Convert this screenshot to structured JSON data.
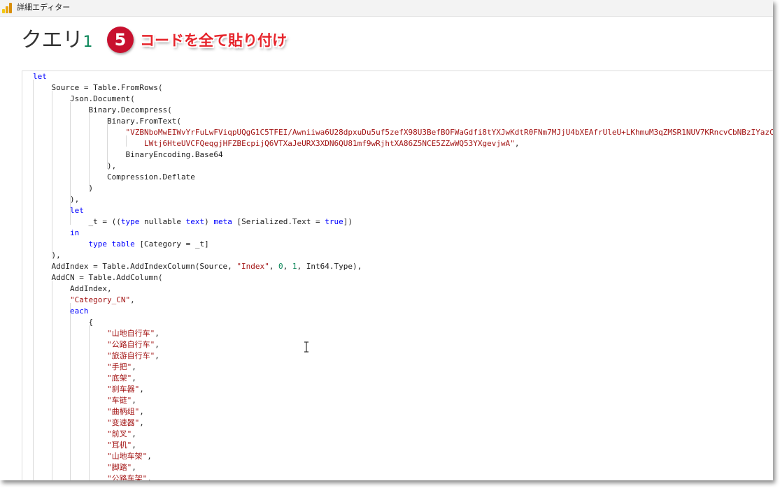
{
  "window": {
    "title": "詳細エディター"
  },
  "header": {
    "query_name": "クエリ",
    "query_number": "1",
    "step_number": "5",
    "step_caption": "コードを全て貼り付け"
  },
  "colors": {
    "keyword": "#0000ff",
    "string": "#a31515",
    "number": "#098658",
    "badge": "#c8102e",
    "caption": "#e6242b"
  },
  "editor": {
    "lines": [
      {
        "indent": 0,
        "tokens": [
          {
            "t": "let",
            "c": "kw"
          }
        ]
      },
      {
        "indent": 1,
        "tokens": [
          {
            "t": "Source = Table.FromRows(",
            "c": ""
          }
        ]
      },
      {
        "indent": 2,
        "tokens": [
          {
            "t": "Json.Document(",
            "c": ""
          }
        ]
      },
      {
        "indent": 3,
        "tokens": [
          {
            "t": "Binary.Decompress(",
            "c": ""
          }
        ]
      },
      {
        "indent": 4,
        "tokens": [
          {
            "t": "Binary.FromText(",
            "c": ""
          }
        ]
      },
      {
        "indent": 5,
        "tokens": [
          {
            "t": "\"VZBNboMwEIWvYrFuLwFViqpUQgG1C5TFEI/Awniiwa6U28dpxuDu5uf5zefX98U3BefBOFWaGdfi8tYXJwKdtR0FNm7MJjU4bXEAfrUleU+LKhmuM3qZMSR1NUV7KRncvCbNBzIYazC",
            "c": "str"
          }
        ]
      },
      {
        "indent": 6,
        "tokens": [
          {
            "t": "LWtj6HteUVCFQeqgjHFZBEcpijQ6VTXaJeURX3XDN6QU81mf9wRjhtXA86Z5NCE5ZZwWQ53YXgevjwA\"",
            "c": "str"
          },
          {
            "t": ",",
            "c": ""
          }
        ]
      },
      {
        "indent": 5,
        "tokens": [
          {
            "t": "BinaryEncoding.Base64",
            "c": ""
          }
        ]
      },
      {
        "indent": 4,
        "tokens": [
          {
            "t": "),",
            "c": ""
          }
        ]
      },
      {
        "indent": 4,
        "tokens": [
          {
            "t": "Compression.Deflate",
            "c": ""
          }
        ]
      },
      {
        "indent": 3,
        "tokens": [
          {
            "t": ")",
            "c": ""
          }
        ]
      },
      {
        "indent": 2,
        "tokens": [
          {
            "t": "),",
            "c": ""
          }
        ]
      },
      {
        "indent": 2,
        "tokens": [
          {
            "t": "let",
            "c": "kw"
          }
        ]
      },
      {
        "indent": 3,
        "tokens": [
          {
            "t": "_t = ((",
            "c": ""
          },
          {
            "t": "type",
            "c": "kw"
          },
          {
            "t": " nullable ",
            "c": ""
          },
          {
            "t": "text",
            "c": "kw"
          },
          {
            "t": ") ",
            "c": ""
          },
          {
            "t": "meta",
            "c": "kw"
          },
          {
            "t": " [Serialized.Text = ",
            "c": ""
          },
          {
            "t": "true",
            "c": "kw"
          },
          {
            "t": "])",
            "c": ""
          }
        ]
      },
      {
        "indent": 2,
        "tokens": [
          {
            "t": "in",
            "c": "kw"
          }
        ]
      },
      {
        "indent": 3,
        "tokens": [
          {
            "t": "type",
            "c": "kw"
          },
          {
            "t": " ",
            "c": ""
          },
          {
            "t": "table",
            "c": "kw"
          },
          {
            "t": " [Category = _t]",
            "c": ""
          }
        ]
      },
      {
        "indent": 1,
        "tokens": [
          {
            "t": "),",
            "c": ""
          }
        ]
      },
      {
        "indent": 1,
        "tokens": [
          {
            "t": "AddIndex = Table.AddIndexColumn(Source, ",
            "c": ""
          },
          {
            "t": "\"Index\"",
            "c": "str"
          },
          {
            "t": ", ",
            "c": ""
          },
          {
            "t": "0",
            "c": "num"
          },
          {
            "t": ", ",
            "c": ""
          },
          {
            "t": "1",
            "c": "num"
          },
          {
            "t": ", Int64.Type),",
            "c": ""
          }
        ]
      },
      {
        "indent": 1,
        "tokens": [
          {
            "t": "AddCN = Table.AddColumn(",
            "c": ""
          }
        ]
      },
      {
        "indent": 2,
        "tokens": [
          {
            "t": "AddIndex,",
            "c": ""
          }
        ]
      },
      {
        "indent": 2,
        "tokens": [
          {
            "t": "\"Category_CN\"",
            "c": "str"
          },
          {
            "t": ",",
            "c": ""
          }
        ]
      },
      {
        "indent": 2,
        "tokens": [
          {
            "t": "each",
            "c": "kw"
          }
        ]
      },
      {
        "indent": 3,
        "tokens": [
          {
            "t": "{",
            "c": ""
          }
        ]
      },
      {
        "indent": 4,
        "tokens": [
          {
            "t": "\"山地自行车\"",
            "c": "str"
          },
          {
            "t": ",",
            "c": ""
          }
        ]
      },
      {
        "indent": 4,
        "tokens": [
          {
            "t": "\"公路自行车\"",
            "c": "str"
          },
          {
            "t": ",",
            "c": ""
          }
        ]
      },
      {
        "indent": 4,
        "tokens": [
          {
            "t": "\"旅游自行车\"",
            "c": "str"
          },
          {
            "t": ",",
            "c": ""
          }
        ]
      },
      {
        "indent": 4,
        "tokens": [
          {
            "t": "\"手把\"",
            "c": "str"
          },
          {
            "t": ",",
            "c": ""
          }
        ]
      },
      {
        "indent": 4,
        "tokens": [
          {
            "t": "\"底架\"",
            "c": "str"
          },
          {
            "t": ",",
            "c": ""
          }
        ]
      },
      {
        "indent": 4,
        "tokens": [
          {
            "t": "\"刹车器\"",
            "c": "str"
          },
          {
            "t": ",",
            "c": ""
          }
        ]
      },
      {
        "indent": 4,
        "tokens": [
          {
            "t": "\"车链\"",
            "c": "str"
          },
          {
            "t": ",",
            "c": ""
          }
        ]
      },
      {
        "indent": 4,
        "tokens": [
          {
            "t": "\"曲柄组\"",
            "c": "str"
          },
          {
            "t": ",",
            "c": ""
          }
        ]
      },
      {
        "indent": 4,
        "tokens": [
          {
            "t": "\"变速器\"",
            "c": "str"
          },
          {
            "t": ",",
            "c": ""
          }
        ]
      },
      {
        "indent": 4,
        "tokens": [
          {
            "t": "\"前叉\"",
            "c": "str"
          },
          {
            "t": ",",
            "c": ""
          }
        ]
      },
      {
        "indent": 4,
        "tokens": [
          {
            "t": "\"耳机\"",
            "c": "str"
          },
          {
            "t": ",",
            "c": ""
          }
        ]
      },
      {
        "indent": 4,
        "tokens": [
          {
            "t": "\"山地车架\"",
            "c": "str"
          },
          {
            "t": ",",
            "c": ""
          }
        ]
      },
      {
        "indent": 4,
        "tokens": [
          {
            "t": "\"脚踏\"",
            "c": "str"
          },
          {
            "t": ",",
            "c": ""
          }
        ]
      },
      {
        "indent": 4,
        "tokens": [
          {
            "t": "\"公路车架\"",
            "c": "str"
          },
          {
            "t": ",",
            "c": ""
          }
        ]
      }
    ]
  }
}
